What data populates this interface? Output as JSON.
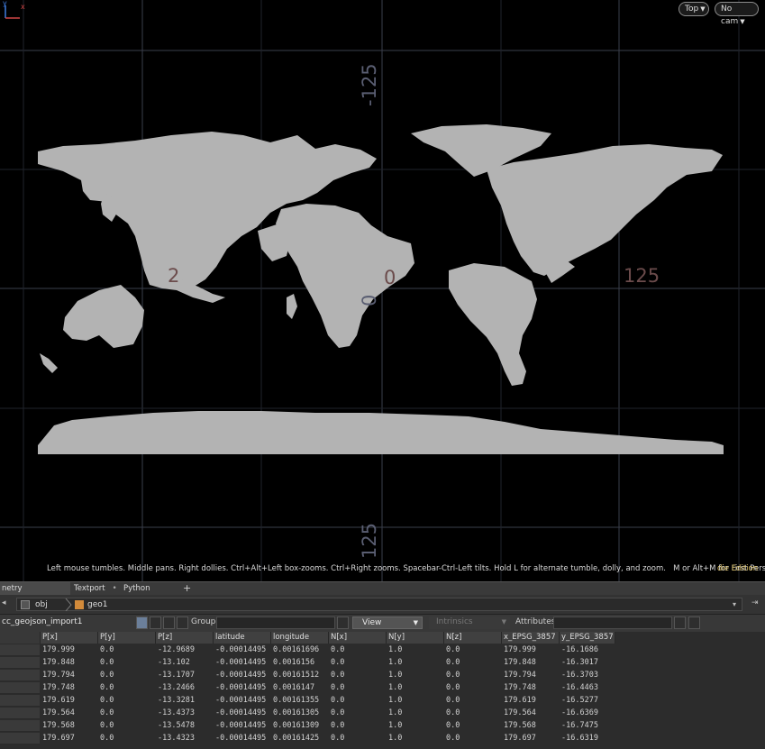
{
  "viewport": {
    "view_label": "Top",
    "camera_label": "No cam",
    "axis_labels": [
      "-125",
      "0",
      "0",
      "125",
      "125",
      "2"
    ],
    "hint": "Left mouse tumbles. Middle pans. Right dollies. Ctrl+Alt+Left box-zooms. Ctrl+Right zooms. Spacebar-Ctrl-Left tilts. Hold L for alternate tumble, dolly, and zoom.",
    "hint2": "M or Alt+M for First Person Navigation.",
    "edition": "die Edition",
    "gizmo": {
      "y": "y",
      "x": "x"
    }
  },
  "tabs": [
    {
      "label": "netry Spreadsheet",
      "active": true
    },
    {
      "label": "Textport",
      "active": false
    },
    {
      "label": "Python Shell",
      "active": false
    }
  ],
  "tab_add": "+",
  "path": {
    "root": "obj",
    "node": "geo1"
  },
  "filter": {
    "node_name": "cc_geojson_import1",
    "group_label": "Group:",
    "view_label": "View",
    "intrinsics_label": "Intrinsics",
    "attributes_label": "Attributes:"
  },
  "table": {
    "columns": [
      "P[x]",
      "P[y]",
      "P[z]",
      "latitude",
      "longitude",
      "N[x]",
      "N[y]",
      "N[z]",
      "x_EPSG_3857",
      "y_EPSG_3857"
    ],
    "rows": [
      [
        "179.999",
        "0.0",
        "-12.9689",
        "-0.00014495",
        "0.00161696",
        "0.0",
        "1.0",
        "0.0",
        "179.999",
        "-16.1686"
      ],
      [
        "179.848",
        "0.0",
        "-13.102",
        "-0.00014495",
        "0.0016156",
        "0.0",
        "1.0",
        "0.0",
        "179.848",
        "-16.3017"
      ],
      [
        "179.794",
        "0.0",
        "-13.1707",
        "-0.00014495",
        "0.00161512",
        "0.0",
        "1.0",
        "0.0",
        "179.794",
        "-16.3703"
      ],
      [
        "179.748",
        "0.0",
        "-13.2466",
        "-0.00014495",
        "0.0016147",
        "0.0",
        "1.0",
        "0.0",
        "179.748",
        "-16.4463"
      ],
      [
        "179.619",
        "0.0",
        "-13.3281",
        "-0.00014495",
        "0.00161355",
        "0.0",
        "1.0",
        "0.0",
        "179.619",
        "-16.5277"
      ],
      [
        "179.564",
        "0.0",
        "-13.4373",
        "-0.00014495",
        "0.00161305",
        "0.0",
        "1.0",
        "0.0",
        "179.564",
        "-16.6369"
      ],
      [
        "179.568",
        "0.0",
        "-13.5478",
        "-0.00014495",
        "0.00161309",
        "0.0",
        "1.0",
        "0.0",
        "179.568",
        "-16.7475"
      ],
      [
        "179.697",
        "0.0",
        "-13.4323",
        "-0.00014495",
        "0.00161425",
        "0.0",
        "1.0",
        "0.0",
        "179.697",
        "-16.6319"
      ]
    ]
  },
  "colors": {
    "background": "#000000",
    "grid": "#3c4250",
    "land": "#b3b3b3",
    "edition": "#e0c46a"
  }
}
